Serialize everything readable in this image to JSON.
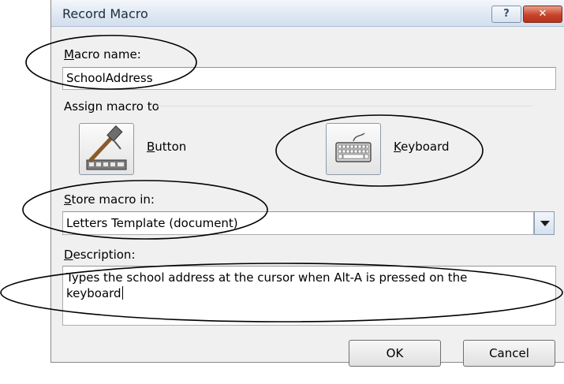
{
  "window": {
    "title": "Record Macro",
    "help_glyph": "?",
    "close_glyph": "✕",
    "help_icon": "help-icon",
    "close_icon": "close-icon"
  },
  "macro_name": {
    "label_hotkey": "M",
    "label_rest": "acro name:",
    "value": "SchoolAddress"
  },
  "assign": {
    "group_label": "Assign macro to",
    "button": {
      "label_hotkey": "B",
      "label_rest": "utton",
      "icon": "hammer-icon"
    },
    "keyboard": {
      "label_hotkey": "K",
      "label_rest": "eyboard",
      "icon": "keyboard-icon"
    }
  },
  "store": {
    "label_hotkey": "S",
    "label_rest": "tore macro in:",
    "value": "Letters Template (document)"
  },
  "description": {
    "label_hotkey": "D",
    "label_rest": "escription:",
    "value_line1": "Types the school address at the cursor when Alt-A is pressed on the",
    "value_line2": "keyboard"
  },
  "buttons": {
    "ok": "OK",
    "cancel": "Cancel"
  },
  "colors": {
    "dialog_bg": "#f0f0f0",
    "titlebar": "#dfe8f3",
    "close_button": "#c8432a",
    "annotation_ellipse": "#000000"
  }
}
